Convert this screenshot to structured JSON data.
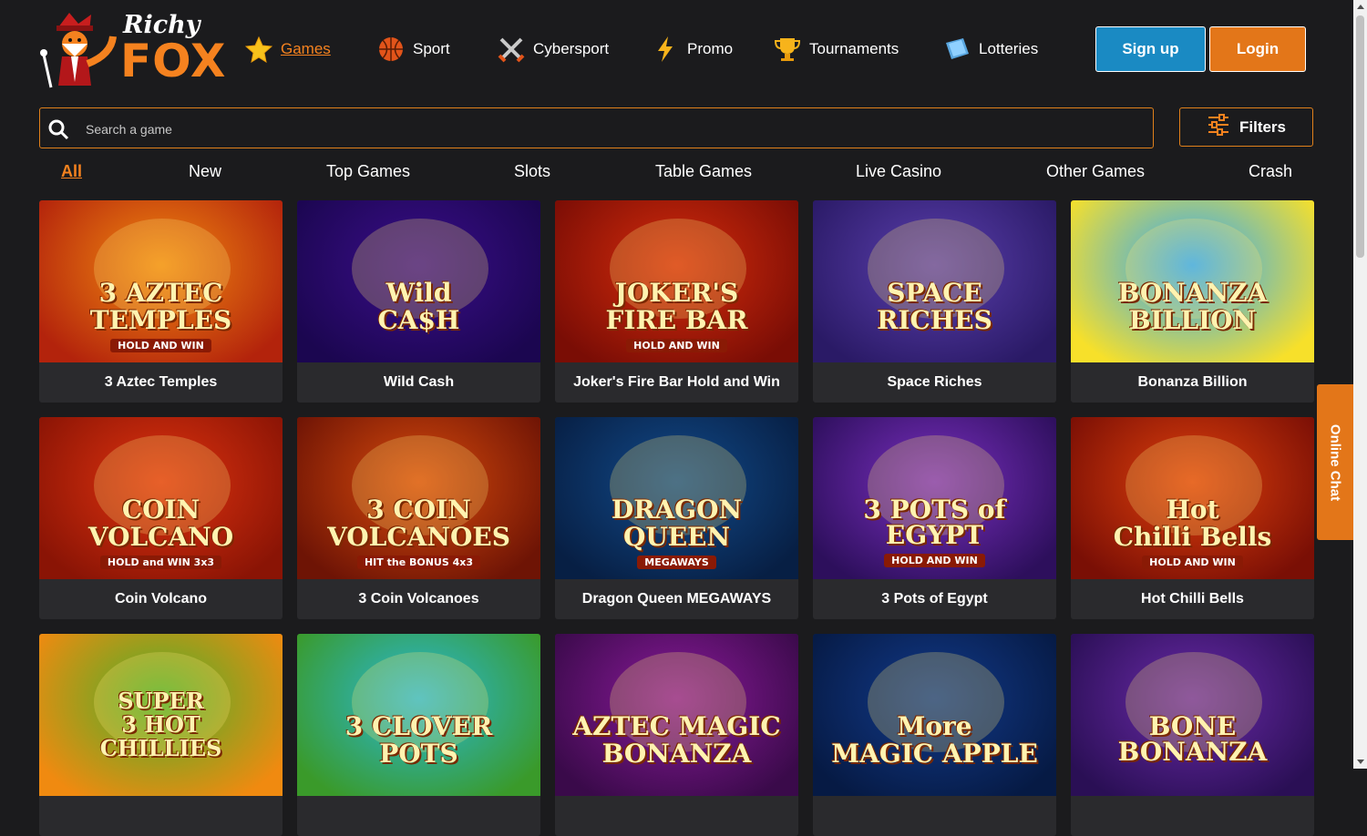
{
  "brand": {
    "line1": "Richy",
    "line2": "FOX"
  },
  "nav": [
    {
      "label": "Games",
      "icon": "star-icon",
      "active": true
    },
    {
      "label": "Sport",
      "icon": "basketball-icon"
    },
    {
      "label": "Cybersport",
      "icon": "crossed-swords-icon"
    },
    {
      "label": "Promo",
      "icon": "lightning-icon"
    },
    {
      "label": "Tournaments",
      "icon": "trophy-icon"
    },
    {
      "label": "Lotteries",
      "icon": "ticket-icon"
    }
  ],
  "auth": {
    "signup": "Sign up",
    "login": "Login"
  },
  "search": {
    "placeholder": "Search a game"
  },
  "filters": {
    "label": "Filters"
  },
  "categories": [
    "All",
    "New",
    "Top Games",
    "Slots",
    "Table Games",
    "Live Casino",
    "Other Games",
    "Crash"
  ],
  "games": [
    {
      "title": "3 Aztec Temples",
      "art": "3 AZTEC|TEMPLES",
      "sub": "HOLD AND WIN"
    },
    {
      "title": "Wild Cash",
      "art": "Wild|CA$H",
      "sub": ""
    },
    {
      "title": "Joker's Fire Bar Hold and Win",
      "art": "JOKER'S|FIRE BAR",
      "sub": "HOLD AND WIN"
    },
    {
      "title": "Space Riches",
      "art": "SPACE|RICHES",
      "sub": ""
    },
    {
      "title": "Bonanza Billion",
      "art": "BONANZA|BILLION",
      "sub": ""
    },
    {
      "title": "Coin Volcano",
      "art": "COIN|VOLCANO",
      "sub": "HOLD and WIN 3x3"
    },
    {
      "title": "3 Coin Volcanoes",
      "art": "3 COIN|VOLCANOES",
      "sub": "HIT the BONUS 4x3"
    },
    {
      "title": "Dragon Queen MEGAWAYS",
      "art": "DRAGON|QUEEN",
      "sub": "MEGAWAYS"
    },
    {
      "title": "3 Pots of Egypt",
      "art": "3 POTS of EGYPT",
      "sub": "HOLD AND WIN"
    },
    {
      "title": "Hot Chilli Bells",
      "art": "Hot|Chilli Bells",
      "sub": "HOLD AND WIN"
    },
    {
      "title": "",
      "art": "SUPER|3 HOT|CHILLIES",
      "sub": ""
    },
    {
      "title": "",
      "art": "3 CLOVER|POTS",
      "sub": ""
    },
    {
      "title": "",
      "art": "AZTEC MAGIC|BONANZA",
      "sub": ""
    },
    {
      "title": "",
      "art": "More|MAGIC APPLE",
      "sub": ""
    },
    {
      "title": "",
      "art": "BONE BONANZA",
      "sub": ""
    }
  ],
  "chat": {
    "label": "Online Chat"
  }
}
